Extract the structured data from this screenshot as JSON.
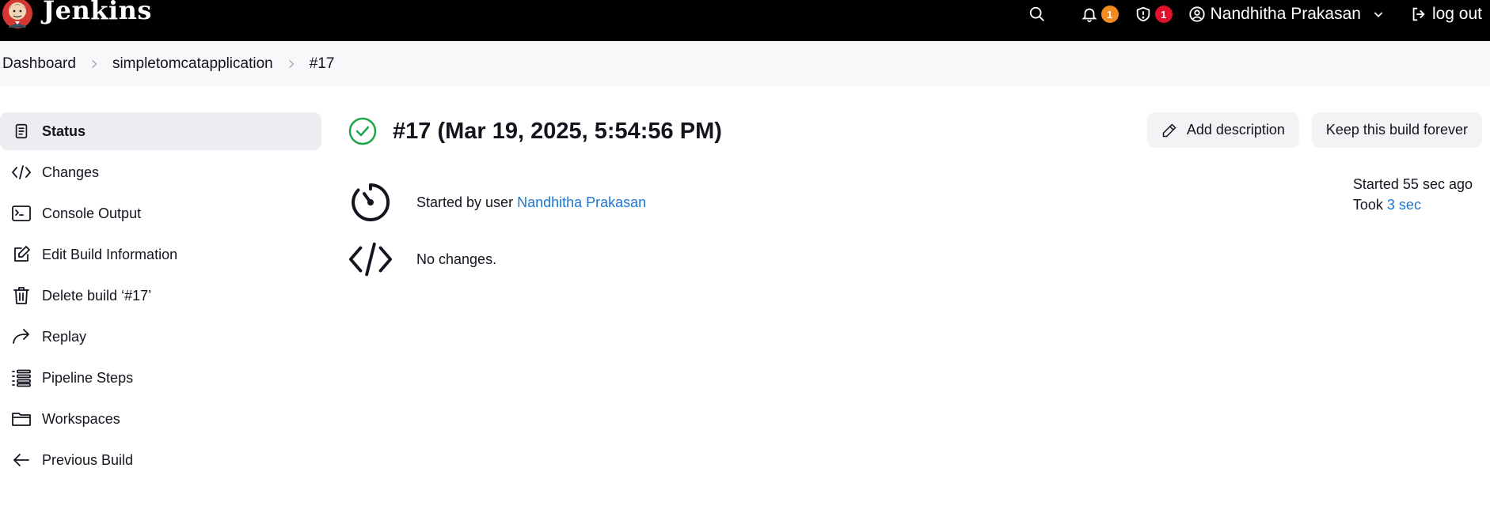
{
  "header": {
    "brand": "Jenkins",
    "notifications_count": "1",
    "security_count": "1",
    "user_name": "Nandhitha Prakasan",
    "logout_label": "log out",
    "colors": {
      "notif_badge": "#f38b1f",
      "security_badge": "#e0112b"
    }
  },
  "breadcrumb": {
    "items": [
      "Dashboard",
      "simpletomcatapplication",
      "#17"
    ]
  },
  "sidebar": {
    "items": [
      {
        "label": "Status",
        "icon": "status-doc-icon"
      },
      {
        "label": "Changes",
        "icon": "code-icon"
      },
      {
        "label": "Console Output",
        "icon": "terminal-icon"
      },
      {
        "label": "Edit Build Information",
        "icon": "edit-icon"
      },
      {
        "label": "Delete build ‘#17’",
        "icon": "trash-icon"
      },
      {
        "label": "Replay",
        "icon": "replay-icon"
      },
      {
        "label": "Pipeline Steps",
        "icon": "list-icon"
      },
      {
        "label": "Workspaces",
        "icon": "folder-icon"
      },
      {
        "label": "Previous Build",
        "icon": "arrow-left-icon"
      }
    ]
  },
  "main": {
    "title": "#17 (Mar 19, 2025, 5:54:56 PM)",
    "add_description_label": "Add description",
    "keep_forever_label": "Keep this build forever",
    "started_by_prefix": "Started by user ",
    "started_by_user": "Nandhitha Prakasan",
    "no_changes": "No changes.",
    "started_ago": "Started 55 sec ago",
    "took_prefix": "Took ",
    "took_value": "3 sec",
    "status_color": "#1ea64b"
  }
}
